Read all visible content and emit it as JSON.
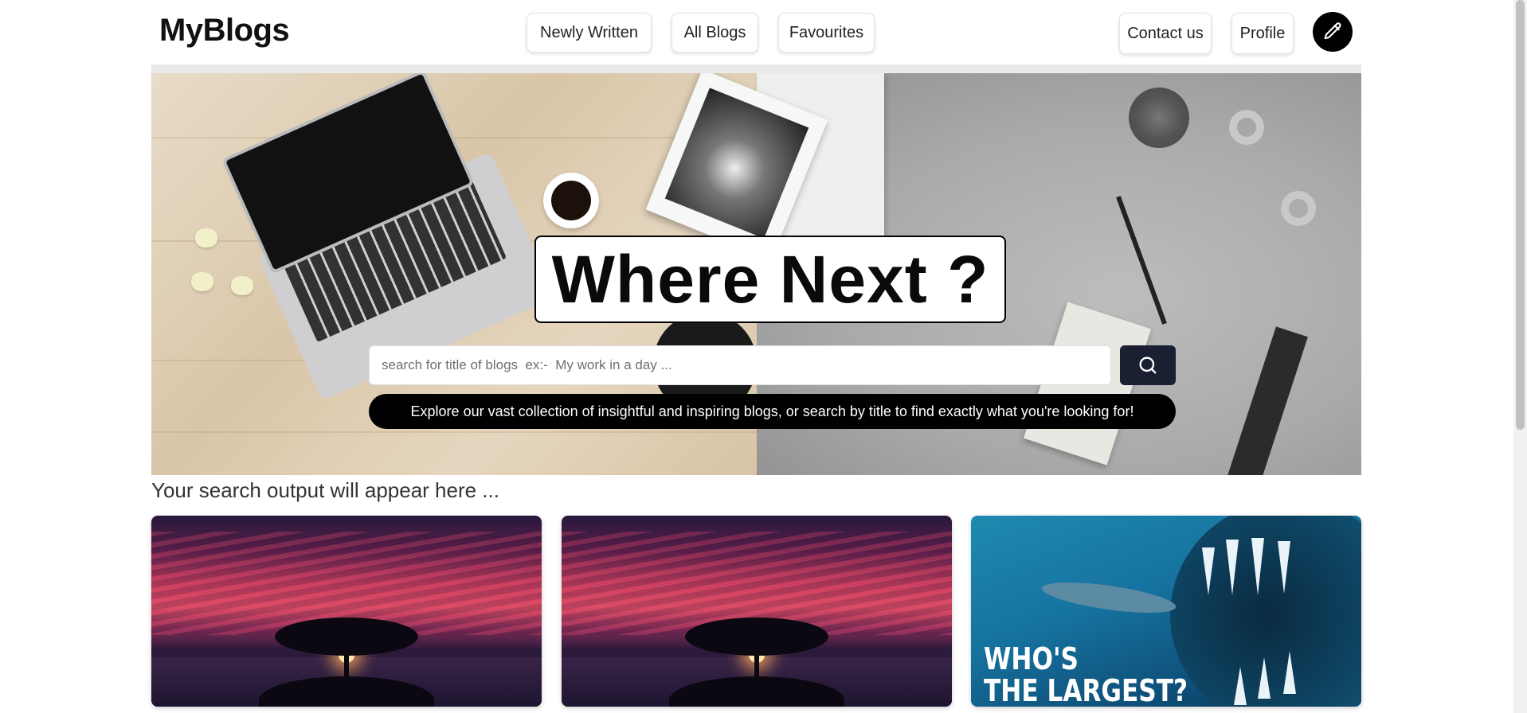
{
  "header": {
    "brand": "MyBlogs",
    "nav": {
      "newly_written": "Newly Written",
      "all_blogs": "All Blogs",
      "favourites": "Favourites",
      "contact_us": "Contact us",
      "profile": "Profile"
    },
    "write_icon": "pencil-icon"
  },
  "hero": {
    "title": "Where Next ?",
    "search": {
      "placeholder": "search for title of blogs  ex:-  My work in a day ...",
      "button_icon": "search-icon"
    },
    "tagline": "Explore our vast collection of insightful and inspiring blogs, or search by title to find exactly what you're looking for!"
  },
  "results": {
    "heading": "Your search output will appear here ...",
    "cards": [
      {
        "image": "sunset-tree"
      },
      {
        "image": "sunset-tree"
      },
      {
        "image": "whale-jaw",
        "overlay_line1": "WHO'S",
        "overlay_line2": "THE LARGEST?"
      }
    ]
  },
  "colors": {
    "search_button": "#1a2031",
    "tagline_background": "#000000",
    "write_button": "#000000"
  }
}
